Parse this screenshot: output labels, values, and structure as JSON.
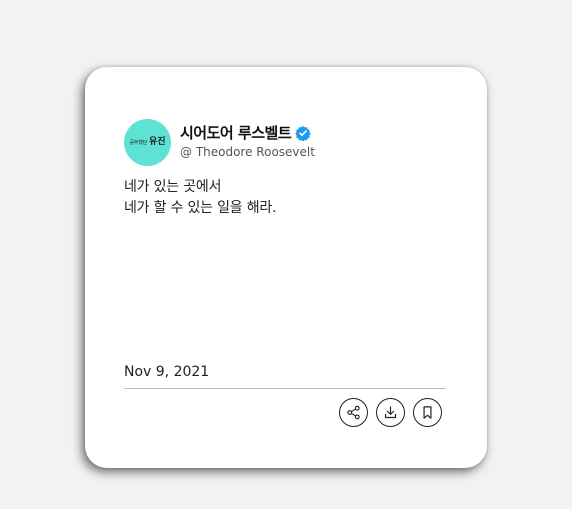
{
  "profile": {
    "avatar_small_text": "공부했던",
    "avatar_mark_text": "유진",
    "name": "시어도어 루스벨트",
    "handle": "@ Theodore Roosevelt",
    "verified_icon": "verified-badge-icon",
    "verified_color": "#1d9bf0",
    "avatar_color": "#5de2d4"
  },
  "post": {
    "lines": [
      "네가 있는 곳에서",
      "네가 할 수 있는 일을 해라."
    ],
    "date": "Nov 9, 2021"
  },
  "actions": [
    {
      "name": "share",
      "icon": "share-icon"
    },
    {
      "name": "download",
      "icon": "download-icon"
    },
    {
      "name": "bookmark",
      "icon": "bookmark-icon"
    }
  ]
}
